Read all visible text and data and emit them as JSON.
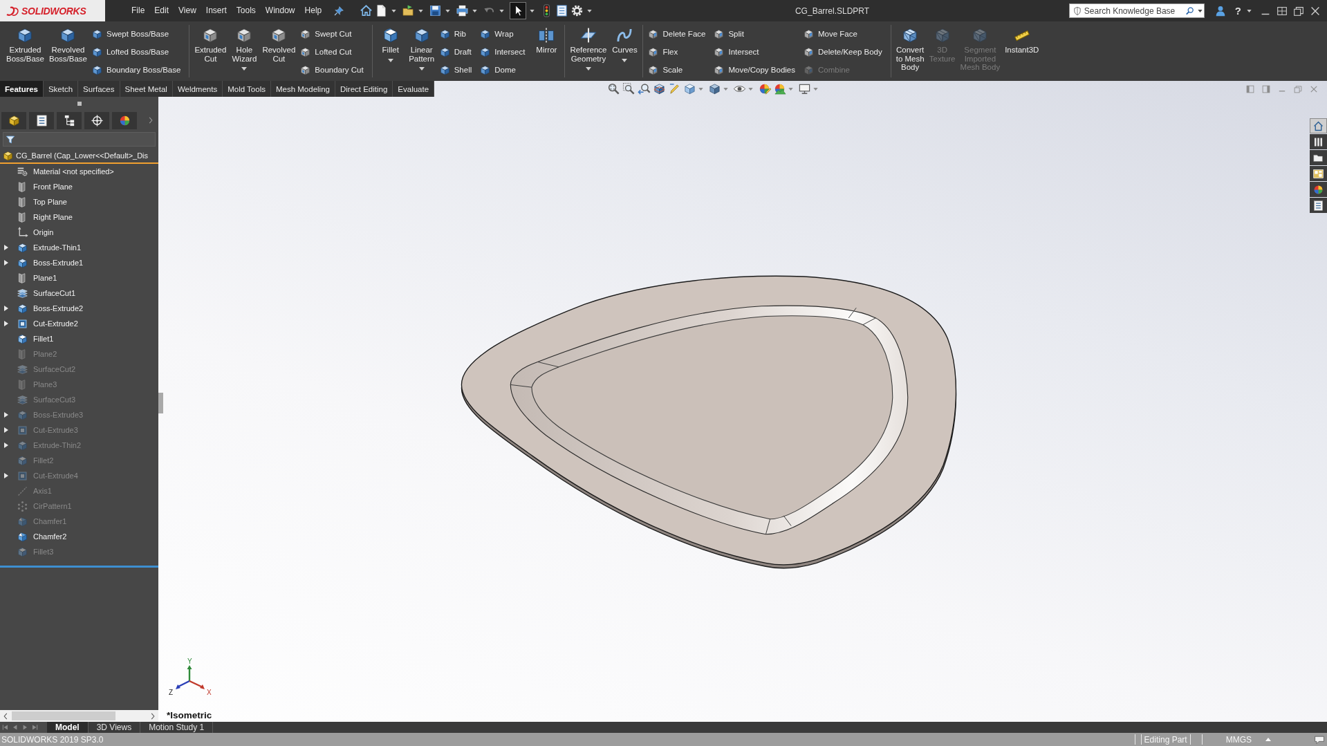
{
  "window": {
    "logo": "SOLIDWORKS",
    "title": "CG_Barrel.SLDPRT",
    "help": "?"
  },
  "menu": [
    "File",
    "Edit",
    "View",
    "Insert",
    "Tools",
    "Window",
    "Help"
  ],
  "search": {
    "placeholder": "Search Knowledge Base"
  },
  "command_manager": {
    "groups": [
      {
        "items": [
          {
            "kind": "large",
            "label": "Extruded\nBoss/Base",
            "dropdown": false,
            "disabled": false
          },
          {
            "kind": "large",
            "label": "Revolved\nBoss/Base",
            "dropdown": false,
            "disabled": false
          },
          {
            "kind": "stack",
            "items": [
              {
                "label": "Swept Boss/Base",
                "disabled": false
              },
              {
                "label": "Lofted Boss/Base",
                "disabled": false
              },
              {
                "label": "Boundary Boss/Base",
                "disabled": false
              }
            ]
          }
        ]
      },
      {
        "items": [
          {
            "kind": "large",
            "label": "Extruded\nCut",
            "dropdown": false,
            "disabled": false
          },
          {
            "kind": "large",
            "label": "Hole\nWizard",
            "dropdown": true,
            "disabled": false
          },
          {
            "kind": "large",
            "label": "Revolved\nCut",
            "dropdown": false,
            "disabled": false
          },
          {
            "kind": "stack",
            "items": [
              {
                "label": "Swept Cut",
                "disabled": false
              },
              {
                "label": "Lofted Cut",
                "disabled": false
              },
              {
                "label": "Boundary Cut",
                "disabled": false
              }
            ]
          }
        ]
      },
      {
        "items": [
          {
            "kind": "large",
            "label": "Fillet",
            "dropdown": true,
            "disabled": false
          },
          {
            "kind": "large",
            "label": "Linear\nPattern",
            "dropdown": true,
            "disabled": false
          },
          {
            "kind": "stack",
            "items": [
              {
                "label": "Rib",
                "disabled": false
              },
              {
                "label": "Draft",
                "disabled": false
              },
              {
                "label": "Shell",
                "disabled": false
              }
            ]
          },
          {
            "kind": "stack",
            "items": [
              {
                "label": "Wrap",
                "disabled": false
              },
              {
                "label": "Intersect",
                "disabled": false
              },
              {
                "label": "Dome",
                "disabled": false
              }
            ]
          },
          {
            "kind": "large",
            "label": "Mirror",
            "dropdown": false,
            "disabled": false
          }
        ]
      },
      {
        "items": [
          {
            "kind": "large",
            "label": "Reference\nGeometry",
            "dropdown": true,
            "disabled": false
          },
          {
            "kind": "large",
            "label": "Curves",
            "dropdown": true,
            "disabled": false
          }
        ]
      },
      {
        "items": [
          {
            "kind": "stack",
            "items": [
              {
                "label": "Delete Face",
                "disabled": false
              },
              {
                "label": "Flex",
                "disabled": false
              },
              {
                "label": "Scale",
                "disabled": false
              }
            ]
          },
          {
            "kind": "stack",
            "items": [
              {
                "label": "Split",
                "disabled": false
              },
              {
                "label": "Intersect",
                "disabled": false
              },
              {
                "label": "Move/Copy Bodies",
                "disabled": false
              }
            ]
          },
          {
            "kind": "stack",
            "items": [
              {
                "label": "Move Face",
                "disabled": false
              },
              {
                "label": "Delete/Keep Body",
                "disabled": false
              },
              {
                "label": "Combine",
                "disabled": true
              }
            ]
          }
        ]
      },
      {
        "items": [
          {
            "kind": "large",
            "label": "Convert\nto Mesh\nBody",
            "dropdown": false,
            "disabled": false
          },
          {
            "kind": "large",
            "label": "3D\nTexture",
            "dropdown": false,
            "disabled": true
          },
          {
            "kind": "large",
            "label": "Segment\nImported\nMesh Body",
            "dropdown": false,
            "disabled": true
          },
          {
            "kind": "large",
            "label": "Instant3D",
            "dropdown": false,
            "disabled": false
          }
        ]
      }
    ]
  },
  "tabs": [
    {
      "label": "Features",
      "selected": true
    },
    {
      "label": "Sketch",
      "selected": false
    },
    {
      "label": "Surfaces",
      "selected": false
    },
    {
      "label": "Sheet Metal",
      "selected": false
    },
    {
      "label": "Weldments",
      "selected": false
    },
    {
      "label": "Mold Tools",
      "selected": false
    },
    {
      "label": "Mesh Modeling",
      "selected": false
    },
    {
      "label": "Direct Editing",
      "selected": false
    },
    {
      "label": "Evaluate",
      "selected": false
    }
  ],
  "feature_tree": {
    "root": "CG_Barrel (Cap_Lower<<Default>_Dis",
    "items": [
      {
        "name": "Material <not specified>",
        "kind": "material",
        "expandable": false,
        "suppressed": false
      },
      {
        "name": "Front Plane",
        "kind": "plane",
        "expandable": false,
        "suppressed": false
      },
      {
        "name": "Top Plane",
        "kind": "plane",
        "expandable": false,
        "suppressed": false
      },
      {
        "name": "Right Plane",
        "kind": "plane",
        "expandable": false,
        "suppressed": false
      },
      {
        "name": "Origin",
        "kind": "origin",
        "expandable": false,
        "suppressed": false
      },
      {
        "name": "Extrude-Thin1",
        "kind": "boss",
        "expandable": true,
        "suppressed": false
      },
      {
        "name": "Boss-Extrude1",
        "kind": "boss",
        "expandable": true,
        "suppressed": false
      },
      {
        "name": "Plane1",
        "kind": "plane",
        "expandable": false,
        "suppressed": false
      },
      {
        "name": "SurfaceCut1",
        "kind": "surfacecut",
        "expandable": false,
        "suppressed": false
      },
      {
        "name": "Boss-Extrude2",
        "kind": "boss",
        "expandable": true,
        "suppressed": false
      },
      {
        "name": "Cut-Extrude2",
        "kind": "cut",
        "expandable": true,
        "suppressed": false
      },
      {
        "name": "Fillet1",
        "kind": "fillet",
        "expandable": false,
        "suppressed": false
      },
      {
        "name": "Plane2",
        "kind": "plane",
        "expandable": false,
        "suppressed": true
      },
      {
        "name": "SurfaceCut2",
        "kind": "surfacecut",
        "expandable": false,
        "suppressed": true
      },
      {
        "name": "Plane3",
        "kind": "plane",
        "expandable": false,
        "suppressed": true
      },
      {
        "name": "SurfaceCut3",
        "kind": "surfacecut",
        "expandable": false,
        "suppressed": true
      },
      {
        "name": "Boss-Extrude3",
        "kind": "boss",
        "expandable": true,
        "suppressed": true
      },
      {
        "name": "Cut-Extrude3",
        "kind": "cut",
        "expandable": true,
        "suppressed": true
      },
      {
        "name": "Extrude-Thin2",
        "kind": "boss",
        "expandable": true,
        "suppressed": true
      },
      {
        "name": "Fillet2",
        "kind": "fillet",
        "expandable": false,
        "suppressed": true
      },
      {
        "name": "Cut-Extrude4",
        "kind": "cut",
        "expandable": true,
        "suppressed": true
      },
      {
        "name": "Axis1",
        "kind": "axis",
        "expandable": false,
        "suppressed": true
      },
      {
        "name": "CirPattern1",
        "kind": "pattern",
        "expandable": false,
        "suppressed": true
      },
      {
        "name": "Chamfer1",
        "kind": "chamfer",
        "expandable": false,
        "suppressed": true
      },
      {
        "name": "Chamfer2",
        "kind": "chamfer",
        "expandable": false,
        "suppressed": false
      },
      {
        "name": "Fillet3",
        "kind": "fillet",
        "expandable": false,
        "suppressed": true
      }
    ]
  },
  "viewport": {
    "view_label": "*Isometric",
    "triad": {
      "x": "X",
      "y": "Y",
      "z": "Z"
    }
  },
  "task_pane": {
    "tabs": [
      {
        "selected": true
      },
      {
        "selected": false
      },
      {
        "selected": false
      },
      {
        "selected": false
      },
      {
        "selected": false
      },
      {
        "selected": false
      }
    ]
  },
  "bottom_tabs": [
    {
      "label": "Model",
      "selected": true
    },
    {
      "label": "3D Views",
      "selected": false
    },
    {
      "label": "Motion Study 1",
      "selected": false
    }
  ],
  "status_bar": {
    "version": "SOLIDWORKS 2019 SP3.0",
    "mode": "Editing Part",
    "units": "MMGS"
  }
}
